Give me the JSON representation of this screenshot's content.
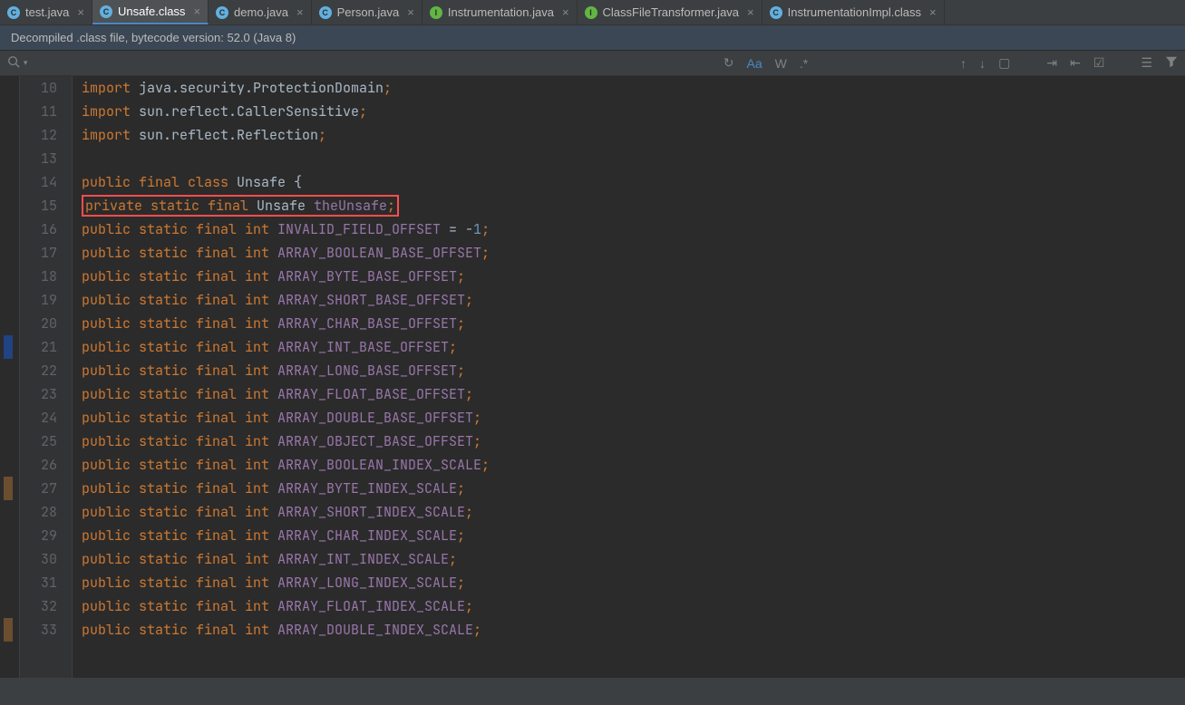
{
  "tabs": [
    {
      "label": "test.java",
      "iconClass": "blue",
      "iconLetter": "C",
      "active": false
    },
    {
      "label": "Unsafe.class",
      "iconClass": "blue",
      "iconLetter": "C",
      "active": true
    },
    {
      "label": "demo.java",
      "iconClass": "blue",
      "iconLetter": "C",
      "active": false
    },
    {
      "label": "Person.java",
      "iconClass": "blue",
      "iconLetter": "C",
      "active": false
    },
    {
      "label": "Instrumentation.java",
      "iconClass": "green",
      "iconLetter": "I",
      "active": false
    },
    {
      "label": "ClassFileTransformer.java",
      "iconClass": "green",
      "iconLetter": "I",
      "active": false
    },
    {
      "label": "InstrumentationImpl.class",
      "iconClass": "blue",
      "iconLetter": "C",
      "active": false
    }
  ],
  "infoBar": "Decompiled .class file, bytecode version: 52.0 (Java 8)",
  "toolbar": {
    "aa": "Aa",
    "w": "W",
    "regex": ".*"
  },
  "lineStart": 10,
  "lines": [
    {
      "n": 10,
      "tokens": [
        [
          "kw",
          "import "
        ],
        [
          "cls",
          "java.security.ProtectionDomain"
        ],
        [
          "punct",
          ";"
        ]
      ]
    },
    {
      "n": 11,
      "tokens": [
        [
          "kw",
          "import "
        ],
        [
          "cls",
          "sun.reflect.CallerSensitive"
        ],
        [
          "punct",
          ";"
        ]
      ]
    },
    {
      "n": 12,
      "tokens": [
        [
          "kw",
          "import "
        ],
        [
          "cls",
          "sun.reflect.Reflection"
        ],
        [
          "punct",
          ";"
        ]
      ]
    },
    {
      "n": 13,
      "tokens": []
    },
    {
      "n": 14,
      "tokens": [
        [
          "kw",
          "public final class "
        ],
        [
          "cls",
          "Unsafe {"
        ]
      ]
    },
    {
      "n": 15,
      "highlight": true,
      "tokens": [
        [
          "kw",
          "private static final "
        ],
        [
          "cls",
          "Unsafe "
        ],
        [
          "const-name",
          "theUnsafe"
        ],
        [
          "punct",
          ";"
        ]
      ]
    },
    {
      "n": 16,
      "tokens": [
        [
          "kw",
          "public static final int "
        ],
        [
          "const-name",
          "INVALID_FIELD_OFFSET"
        ],
        [
          "cls",
          " = -"
        ],
        [
          "num",
          "1"
        ],
        [
          "punct",
          ";"
        ]
      ]
    },
    {
      "n": 17,
      "tokens": [
        [
          "kw",
          "public static final int "
        ],
        [
          "const-name",
          "ARRAY_BOOLEAN_BASE_OFFSET"
        ],
        [
          "punct",
          ";"
        ]
      ]
    },
    {
      "n": 18,
      "tokens": [
        [
          "kw",
          "public static final int "
        ],
        [
          "const-name",
          "ARRAY_BYTE_BASE_OFFSET"
        ],
        [
          "punct",
          ";"
        ]
      ]
    },
    {
      "n": 19,
      "tokens": [
        [
          "kw",
          "public static final int "
        ],
        [
          "const-name",
          "ARRAY_SHORT_BASE_OFFSET"
        ],
        [
          "punct",
          ";"
        ]
      ]
    },
    {
      "n": 20,
      "tokens": [
        [
          "kw",
          "public static final int "
        ],
        [
          "const-name",
          "ARRAY_CHAR_BASE_OFFSET"
        ],
        [
          "punct",
          ";"
        ]
      ]
    },
    {
      "n": 21,
      "tokens": [
        [
          "kw",
          "public static final int "
        ],
        [
          "const-name",
          "ARRAY_INT_BASE_OFFSET"
        ],
        [
          "punct",
          ";"
        ]
      ]
    },
    {
      "n": 22,
      "tokens": [
        [
          "kw",
          "public static final int "
        ],
        [
          "const-name",
          "ARRAY_LONG_BASE_OFFSET"
        ],
        [
          "punct",
          ";"
        ]
      ]
    },
    {
      "n": 23,
      "tokens": [
        [
          "kw",
          "public static final int "
        ],
        [
          "const-name",
          "ARRAY_FLOAT_BASE_OFFSET"
        ],
        [
          "punct",
          ";"
        ]
      ]
    },
    {
      "n": 24,
      "tokens": [
        [
          "kw",
          "public static final int "
        ],
        [
          "const-name",
          "ARRAY_DOUBLE_BASE_OFFSET"
        ],
        [
          "punct",
          ";"
        ]
      ]
    },
    {
      "n": 25,
      "tokens": [
        [
          "kw",
          "public static final int "
        ],
        [
          "const-name",
          "ARRAY_OBJECT_BASE_OFFSET"
        ],
        [
          "punct",
          ";"
        ]
      ]
    },
    {
      "n": 26,
      "tokens": [
        [
          "kw",
          "public static final int "
        ],
        [
          "const-name",
          "ARRAY_BOOLEAN_INDEX_SCALE"
        ],
        [
          "punct",
          ";"
        ]
      ]
    },
    {
      "n": 27,
      "tokens": [
        [
          "kw",
          "public static final int "
        ],
        [
          "const-name",
          "ARRAY_BYTE_INDEX_SCALE"
        ],
        [
          "punct",
          ";"
        ]
      ]
    },
    {
      "n": 28,
      "tokens": [
        [
          "kw",
          "public static final int "
        ],
        [
          "const-name",
          "ARRAY_SHORT_INDEX_SCALE"
        ],
        [
          "punct",
          ";"
        ]
      ]
    },
    {
      "n": 29,
      "tokens": [
        [
          "kw",
          "public static final int "
        ],
        [
          "const-name",
          "ARRAY_CHAR_INDEX_SCALE"
        ],
        [
          "punct",
          ";"
        ]
      ]
    },
    {
      "n": 30,
      "tokens": [
        [
          "kw",
          "public static final int "
        ],
        [
          "const-name",
          "ARRAY_INT_INDEX_SCALE"
        ],
        [
          "punct",
          ";"
        ]
      ]
    },
    {
      "n": 31,
      "tokens": [
        [
          "kw",
          "public static final int "
        ],
        [
          "const-name",
          "ARRAY_LONG_INDEX_SCALE"
        ],
        [
          "punct",
          ";"
        ]
      ]
    },
    {
      "n": 32,
      "tokens": [
        [
          "kw",
          "public static final int "
        ],
        [
          "const-name",
          "ARRAY_FLOAT_INDEX_SCALE"
        ],
        [
          "punct",
          ";"
        ]
      ]
    },
    {
      "n": 33,
      "tokens": [
        [
          "kw",
          "public static final int "
        ],
        [
          "const-name",
          "ARRAY_DOUBLE_INDEX_SCALE"
        ],
        [
          "punct",
          ";"
        ]
      ]
    }
  ]
}
